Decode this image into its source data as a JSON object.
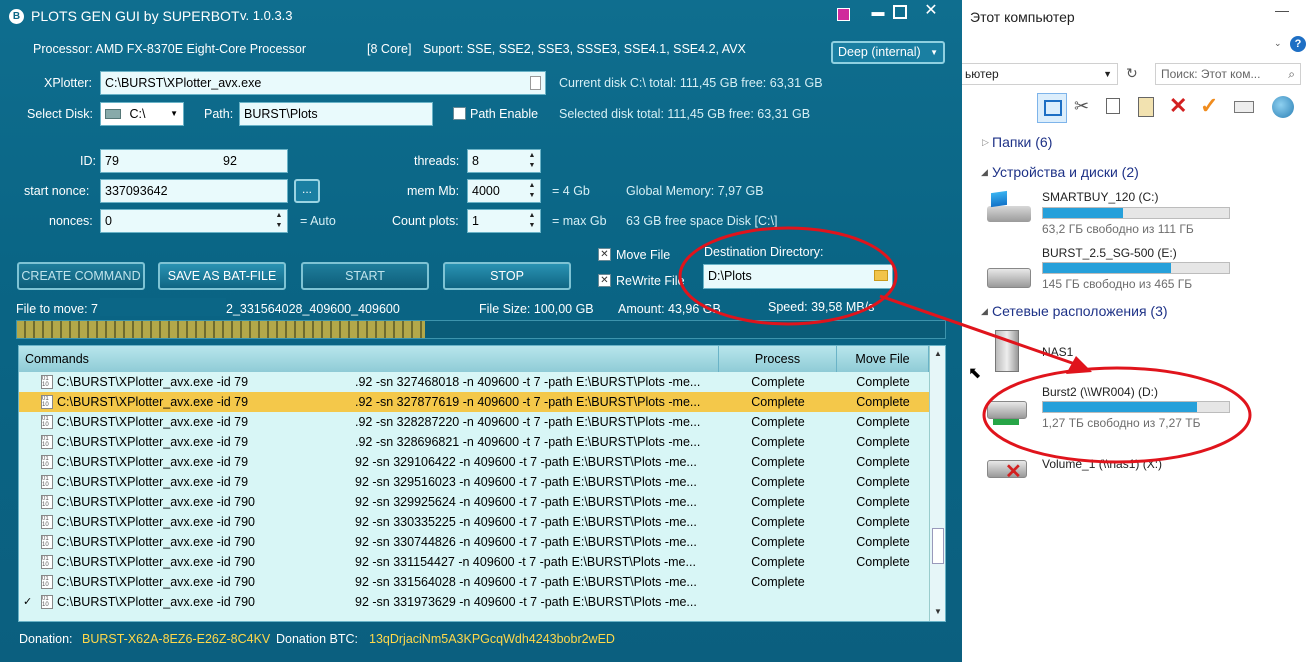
{
  "app": {
    "title": "PLOTS GEN GUI by SUPERBOT",
    "version": "v. 1.0.3.3",
    "processor": "Processor: AMD FX-8370E Eight-Core Processor",
    "cores": "[8 Core]",
    "support": "Suport: SSE, SSE2, SSE3, SSSE3, SSE4.1, SSE4.2, AVX",
    "mode_select": "Deep (internal)",
    "xplotter_label": "XPlotter:",
    "xplotter_value": "C:\\BURST\\XPlotter_avx.exe",
    "current_disk": "Current disk  C:\\ total: 111,45 GB free: 63,31 GB",
    "select_disk_label": "Select Disk:",
    "select_disk_value": "C:\\",
    "path_label": "Path:",
    "path_value": "BURST\\Plots",
    "path_enable_label": "Path Enable",
    "selected_disk": "Selected disk  total: 111,45 GB free: 63,31 GB",
    "id_label": "ID:",
    "id_value_a": "79",
    "id_value_b": "92",
    "threads_label": "threads:",
    "threads_value": "8",
    "start_nonce_label": "start nonce:",
    "start_nonce_value": "337093642",
    "browse_label": "...",
    "mem_label": "mem Mb:",
    "mem_value": "4000",
    "mem_note": "= 4 Gb",
    "global_memory": "Global Memory: 7,97 GB",
    "nonces_label": "nonces:",
    "nonces_value": "0",
    "nonces_note": "= Auto",
    "count_label": "Count plots:",
    "count_value": "1",
    "count_note": "= max Gb",
    "free_space": "63 GB free space Disk [C:\\]",
    "move_file_label": "Move File",
    "rewrite_file_label": "ReWrite File",
    "dest_label": "Destination  Directory:",
    "dest_value": "D:\\Plots",
    "create_command": "CREATE COMMAND",
    "save_bat": "SAVE AS BAT-FILE",
    "start": "START",
    "stop": "STOP",
    "file_to_move_label": "File to move: 7",
    "file_to_move_value": "2_331564028_409600_409600",
    "file_size": "File Size: 100,00 GB",
    "amount": "Amount: 43,96 GB",
    "speed": "Speed: 39,58 MB/s",
    "progress": 0.44,
    "columns": [
      "Commands",
      "Process",
      "Move File"
    ],
    "rows": [
      {
        "cmd": "C:\\BURST\\XPlotter_avx.exe -id 79",
        "args": ".92 -sn 327468018 -n 409600 -t 7 -path E:\\BURST\\Plots -me...",
        "process": "Complete",
        "move": "Complete",
        "check": "",
        "selected": false
      },
      {
        "cmd": "C:\\BURST\\XPlotter_avx.exe -id 79",
        "args": ".92 -sn 327877619 -n 409600 -t 7 -path E:\\BURST\\Plots -me...",
        "process": "Complete",
        "move": "Complete",
        "check": "",
        "selected": true
      },
      {
        "cmd": "C:\\BURST\\XPlotter_avx.exe -id 79",
        "args": ".92 -sn 328287220 -n 409600 -t 7 -path E:\\BURST\\Plots -me...",
        "process": "Complete",
        "move": "Complete",
        "check": "",
        "selected": false
      },
      {
        "cmd": "C:\\BURST\\XPlotter_avx.exe -id 79",
        "args": ".92 -sn 328696821 -n 409600 -t 7 -path E:\\BURST\\Plots -me...",
        "process": "Complete",
        "move": "Complete",
        "check": "",
        "selected": false
      },
      {
        "cmd": "C:\\BURST\\XPlotter_avx.exe -id 79",
        "args": "92 -sn 329106422 -n 409600 -t 7 -path E:\\BURST\\Plots -me...",
        "process": "Complete",
        "move": "Complete",
        "check": "",
        "selected": false
      },
      {
        "cmd": "C:\\BURST\\XPlotter_avx.exe -id 79",
        "args": "92 -sn 329516023 -n 409600 -t 7 -path E:\\BURST\\Plots -me...",
        "process": "Complete",
        "move": "Complete",
        "check": "",
        "selected": false
      },
      {
        "cmd": "C:\\BURST\\XPlotter_avx.exe -id 790",
        "args": "92 -sn 329925624 -n 409600 -t 7 -path E:\\BURST\\Plots -me...",
        "process": "Complete",
        "move": "Complete",
        "check": "",
        "selected": false
      },
      {
        "cmd": "C:\\BURST\\XPlotter_avx.exe -id 790",
        "args": "92 -sn 330335225 -n 409600 -t 7 -path E:\\BURST\\Plots -me...",
        "process": "Complete",
        "move": "Complete",
        "check": "",
        "selected": false
      },
      {
        "cmd": "C:\\BURST\\XPlotter_avx.exe -id 790",
        "args": "92 -sn 330744826 -n 409600 -t 7 -path E:\\BURST\\Plots -me...",
        "process": "Complete",
        "move": "Complete",
        "check": "",
        "selected": false
      },
      {
        "cmd": "C:\\BURST\\XPlotter_avx.exe -id 790",
        "args": "92 -sn 331154427 -n 409600 -t 7 -path E:\\BURST\\Plots -me...",
        "process": "Complete",
        "move": "Complete",
        "check": "",
        "selected": false
      },
      {
        "cmd": "C:\\BURST\\XPlotter_avx.exe -id 790",
        "args": "92 -sn 331564028 -n 409600 -t 7 -path E:\\BURST\\Plots -me...",
        "process": "Complete",
        "move": "",
        "check": "",
        "selected": false
      },
      {
        "cmd": "C:\\BURST\\XPlotter_avx.exe -id 790",
        "args": "92 -sn 331973629 -n 409600 -t 7 -path E:\\BURST\\Plots -me...",
        "process": "",
        "move": "",
        "check": "✓",
        "selected": false
      }
    ],
    "donation_label": "Donation:",
    "donation_value": "BURST-X62A-8EZ6-E26Z-8C4KV",
    "donation_btc_label": "Donation BTC:",
    "donation_btc_value": "13qDrjaciNm5A3KPGcqWdh4243bobr2wED"
  },
  "explorer": {
    "title": "Этот компьютер",
    "address": "ьютер",
    "search_placeholder": "Поиск: Этот ком...",
    "folders": "Папки (6)",
    "devices": "Устройства и диски (2)",
    "network": "Сетевые расположения (3)",
    "drives": [
      {
        "name": "SMARTBUY_120 (C:)",
        "free": "63,2 ГБ свободно из 111 ГБ",
        "used": 0.43
      },
      {
        "name": "BURST_2.5_SG-500 (E:)",
        "free": "145 ГБ свободно из 465 ГБ",
        "used": 0.69
      }
    ],
    "network_items": [
      {
        "name": "NAS1"
      },
      {
        "name": "Burst2 (\\\\WR004) (D:)",
        "free": "1,27 ТБ свободно из 7,27 ТБ",
        "used": 0.83
      },
      {
        "name": "Volume_1 (\\\\nas1) (X:)"
      }
    ]
  },
  "colors": {
    "app_bg": "#0b6686",
    "accent_annotation": "#e0141c",
    "selected_row": "#f4c84a",
    "donation_text": "#ffd84a",
    "drive_bar": "#26a0da"
  }
}
